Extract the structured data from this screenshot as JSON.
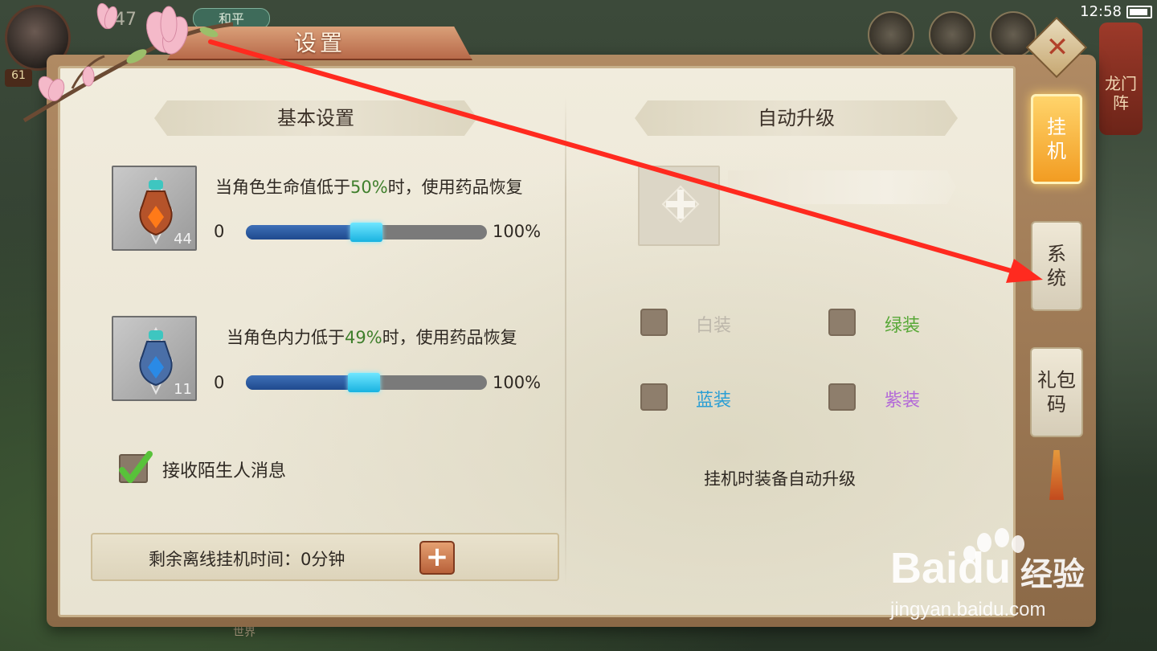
{
  "hud": {
    "player_level": "61",
    "power": "347",
    "peace_mode": "和平",
    "clock": "12:58",
    "longmen": "龙门阵",
    "world": "世界"
  },
  "dialog": {
    "title": "设置",
    "close_icon": "close-x-icon"
  },
  "basic": {
    "header": "基本设置",
    "hp": {
      "text_before": "当角色生命值低于",
      "percent": "50%",
      "text_after": "时，使用药品恢复",
      "count": "44",
      "min": "0",
      "max": "100%",
      "value": 0.5,
      "icon": "hp-potion-icon"
    },
    "mp": {
      "text_before": "当角色内力低于",
      "percent": "49%",
      "text_after": "时，使用药品恢复",
      "count": "11",
      "min": "0",
      "max": "100%",
      "value": 0.49,
      "icon": "mp-potion-icon"
    },
    "stranger_label": "接收陌生人消息",
    "stranger_checked": true,
    "offline_text": "剩余离线挂机时间：0分钟",
    "offline_add": "+"
  },
  "auto": {
    "header": "自动升级",
    "filters": {
      "white": "白装",
      "green": "绿装",
      "blue": "蓝装",
      "purple": "紫装"
    },
    "desc": "挂机时装备自动升级"
  },
  "tabs": {
    "guaji": "挂机",
    "xitong": "系统",
    "libao": "礼包码"
  },
  "watermark": {
    "brand": "Baidu",
    "brand_cn": "经验",
    "url": "jingyan.baidu.com"
  },
  "colors": {
    "accent_orange": "#f29c22",
    "slider_blue": "#1f4a8e",
    "slider_thumb": "#19b2e0",
    "arrow_red": "#ff2a1f",
    "highlight_green": "#3f7f2c"
  }
}
